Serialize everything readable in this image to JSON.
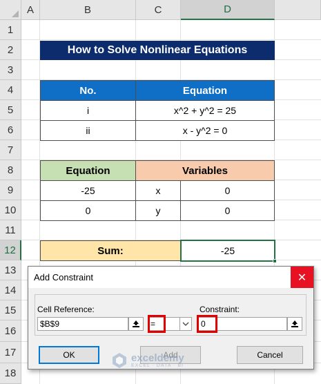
{
  "columns": [
    "A",
    "B",
    "C",
    "D"
  ],
  "rows": [
    "1",
    "2",
    "3",
    "4",
    "5",
    "6",
    "7",
    "8",
    "9",
    "10",
    "11",
    "12",
    "13",
    "14",
    "15",
    "16",
    "17",
    "18"
  ],
  "title": "How to Solve Nonlinear Equations",
  "table1": {
    "headers": [
      "No.",
      "Equation"
    ],
    "rows": [
      [
        "i",
        "x^2 + y^2 = 25"
      ],
      [
        "ii",
        "x - y^2 = 0"
      ]
    ]
  },
  "table2": {
    "headers": [
      "Equation",
      "Variables"
    ],
    "rows": [
      [
        "-25",
        "x",
        "0"
      ],
      [
        "0",
        "y",
        "0"
      ]
    ]
  },
  "sum": {
    "label": "Sum:",
    "value": "-25"
  },
  "dialog": {
    "title": "Add Constraint",
    "close": "✕",
    "cell_ref_label": "Cell Reference:",
    "cell_ref_value": "$B$9",
    "operator": "=",
    "constraint_label": "Constraint:",
    "constraint_value": "0",
    "ok": "OK",
    "add": "Add",
    "cancel": "Cancel"
  },
  "watermark": {
    "name": "exceldemy",
    "tagline": "EXCEL · DATA · BI"
  },
  "colors": {
    "title_bg": "#0c2c6e",
    "header_blue": "#0f6fc6",
    "header_green": "#c6e0b4",
    "header_orange": "#f8cbad",
    "sum_bg": "#ffe6a8",
    "excel_green": "#217346",
    "highlight_red": "#e00000"
  }
}
